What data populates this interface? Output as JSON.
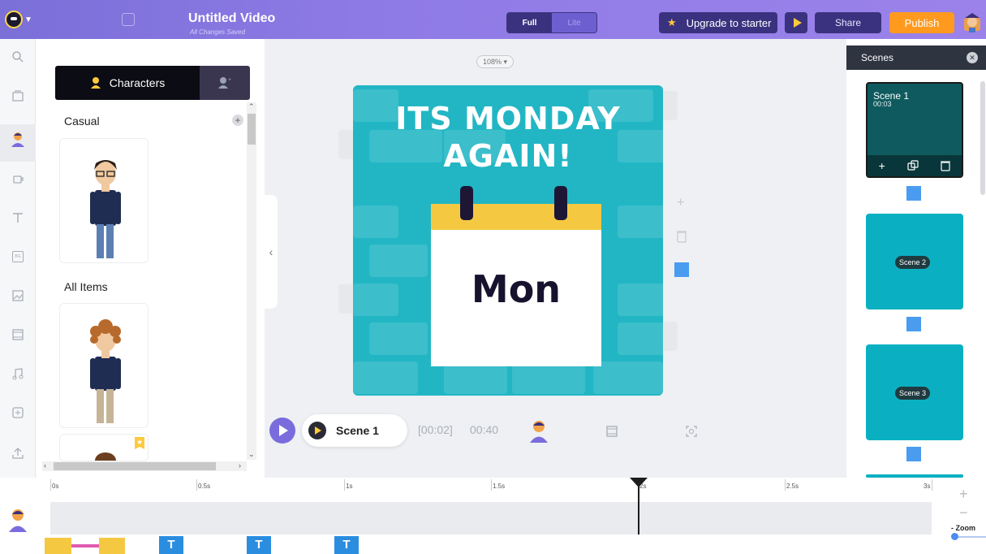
{
  "header": {
    "title": "Untitled Video",
    "subtitle": "All Changes Saved",
    "mode_full": "Full",
    "mode_lite": "Lite",
    "upgrade_label": "Upgrade to starter",
    "share_label": "Share",
    "publish_label": "Publish"
  },
  "library": {
    "tab_characters": "Characters",
    "section_casual": "Casual",
    "section_all_items": "All Items"
  },
  "canvas": {
    "zoom_level": "108%",
    "headline_line1": "ITS MONDAY",
    "headline_line2": "AGAIN!",
    "calendar_text": "Mon"
  },
  "playbar": {
    "scene_label": "Scene 1",
    "current_time": "[00:02]",
    "total_time": "00:40"
  },
  "scenes_panel": {
    "title": "Scenes",
    "scenes": [
      {
        "name": "Scene 1",
        "duration": "00:03"
      },
      {
        "name": "Scene 2"
      },
      {
        "name": "Scene 3"
      }
    ]
  },
  "timeline": {
    "ruler": [
      "0s",
      "0.5s",
      "1s",
      "1.5s",
      "2s",
      "2.5s",
      "3s"
    ],
    "zoom_label": "Zoom",
    "text_clip_label": "T"
  },
  "colors": {
    "header_gradient_start": "#7b6fd8",
    "publish_button": "#ff9a1f",
    "scene_teal": "#22b6c4",
    "calendar_yellow": "#f5c842",
    "accent_blue": "#4a9cf0"
  }
}
